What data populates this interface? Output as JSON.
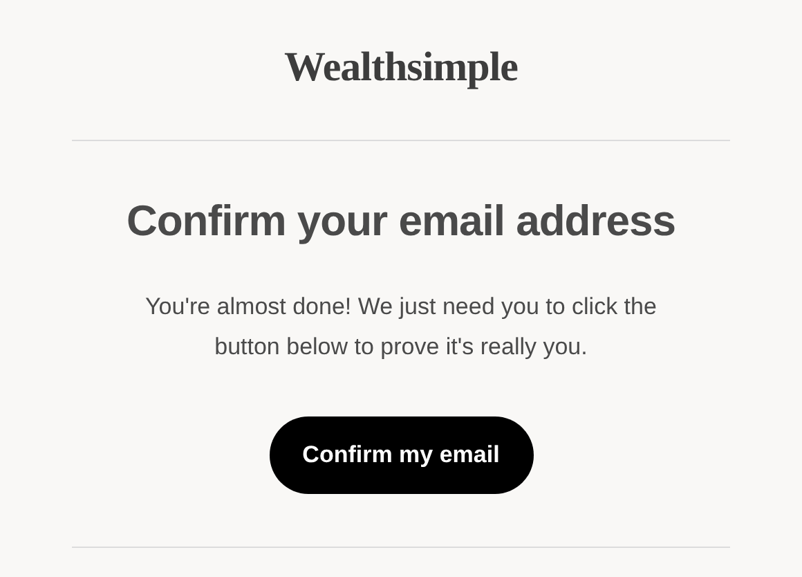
{
  "logo": "Wealthsimple",
  "heading": "Confirm your email address",
  "message": "You're almost done! We just need you to click the button below to prove it's really you.",
  "button": "Confirm my email"
}
